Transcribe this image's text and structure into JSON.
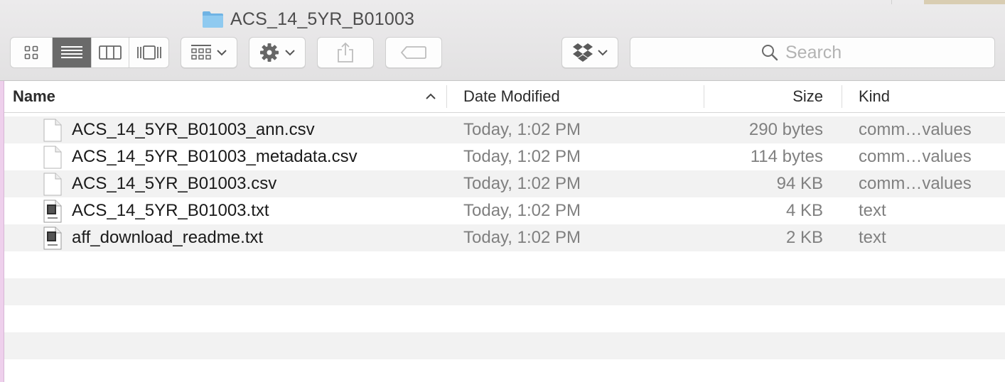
{
  "window": {
    "title": "ACS_14_5YR_B01003",
    "title_icon": "folder-icon"
  },
  "toolbar": {
    "view_buttons": [
      {
        "name": "icon-view",
        "icon": "grid-icon",
        "active": false
      },
      {
        "name": "list-view",
        "icon": "list-icon",
        "active": true
      },
      {
        "name": "column-view",
        "icon": "columns-icon",
        "active": false
      },
      {
        "name": "coverflow-view",
        "icon": "coverflow-icon",
        "active": false
      }
    ],
    "arrange_icon": "arrange-grid-icon",
    "action_icon": "gear-icon",
    "share_icon": "share-icon",
    "tags_icon": "tag-icon",
    "dropbox_icon": "dropbox-icon",
    "search_placeholder": "Search"
  },
  "columns": {
    "name": "Name",
    "date": "Date Modified",
    "size": "Size",
    "kind": "Kind",
    "sort_indicator": "chevron-up-icon"
  },
  "files": [
    {
      "name": "ACS_14_5YR_B01003_ann.csv",
      "date": "Today, 1:02 PM",
      "size": "290 bytes",
      "kind": "comm…values",
      "icon": "document-icon"
    },
    {
      "name": "ACS_14_5YR_B01003_metadata.csv",
      "date": "Today, 1:02 PM",
      "size": "114 bytes",
      "kind": "comm…values",
      "icon": "document-icon"
    },
    {
      "name": "ACS_14_5YR_B01003.csv",
      "date": "Today, 1:02 PM",
      "size": "94 KB",
      "kind": "comm…values",
      "icon": "document-icon"
    },
    {
      "name": "ACS_14_5YR_B01003.txt",
      "date": "Today, 1:02 PM",
      "size": "4 KB",
      "kind": "text",
      "icon": "text-file-icon"
    },
    {
      "name": "aff_download_readme.txt",
      "date": "Today, 1:02 PM",
      "size": "2 KB",
      "kind": "text",
      "icon": "text-file-icon"
    }
  ],
  "colors": {
    "toolbar_bg": "#e6e5e6",
    "alt_row": "#f2f2f2",
    "active_segment": "#6a6a6a",
    "folder_blue": "#79bde8",
    "left_accent": "#eed0ec"
  }
}
